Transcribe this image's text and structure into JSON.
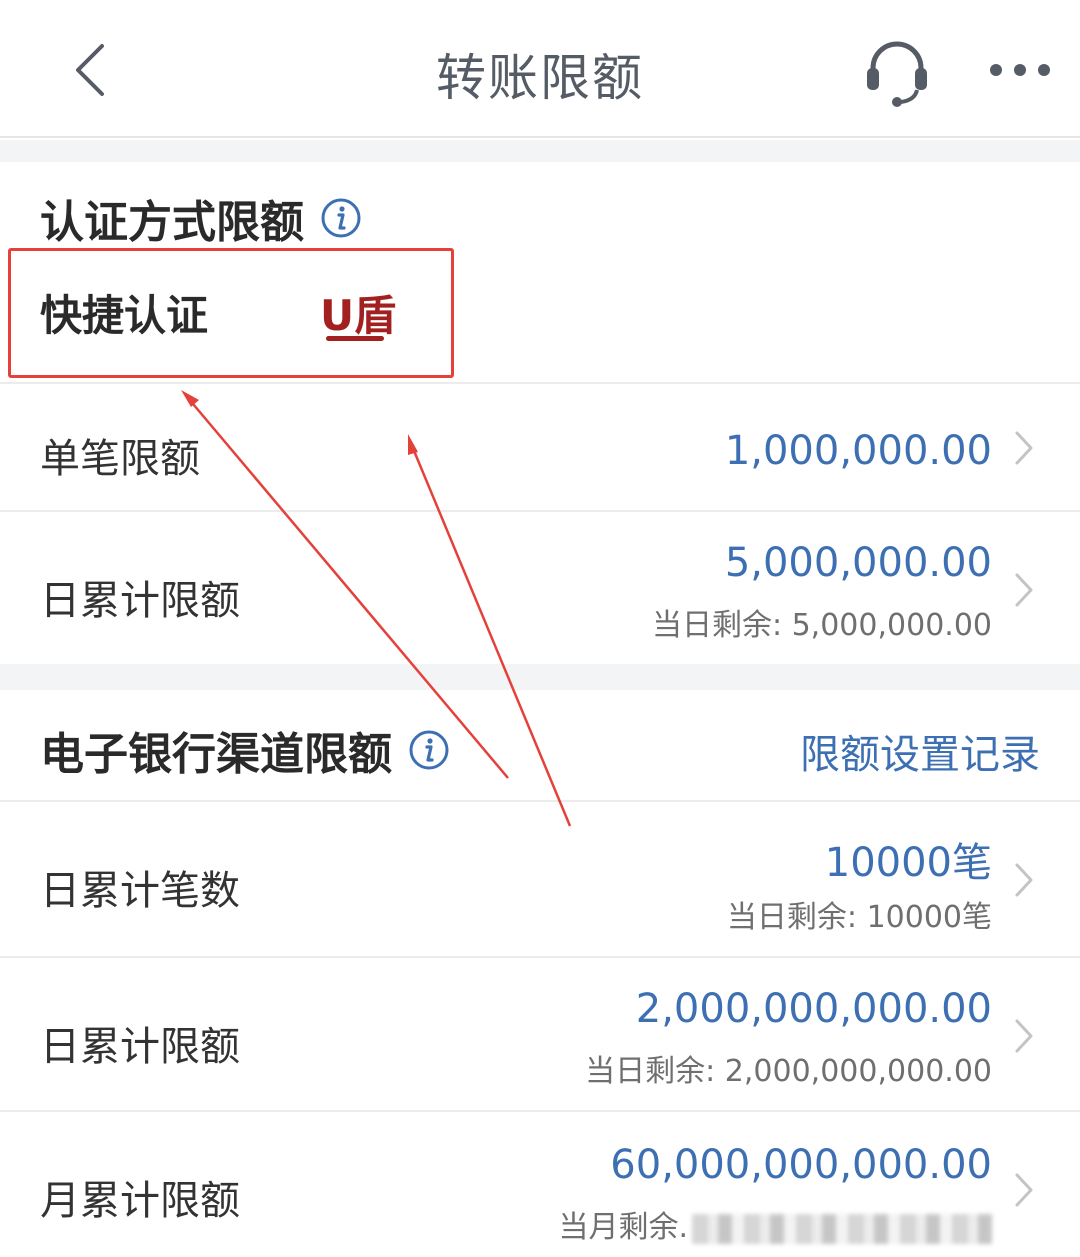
{
  "header": {
    "title": "转账限额",
    "back_icon": "chevron-left-icon",
    "support_icon": "headset-icon",
    "more_icon": "more-dots-icon"
  },
  "auth_section": {
    "title": "认证方式限额",
    "info_icon": "info-icon",
    "method_label": "快捷认证",
    "method_value": "U盾",
    "rows": [
      {
        "label": "单笔限额",
        "value": "1,000,000.00"
      },
      {
        "label": "日累计限额",
        "value": "5,000,000.00",
        "sub": "当日剩余: 5,000,000.00"
      }
    ]
  },
  "channel_section": {
    "title": "电子银行渠道限额",
    "info_icon": "info-icon",
    "records_link": "限额设置记录",
    "rows": [
      {
        "label": "日累计笔数",
        "value": "10000笔",
        "sub": "当日剩余: 10000笔"
      },
      {
        "label": "日累计限额",
        "value": "2,000,000,000.00",
        "sub": "当日剩余: 2,000,000,000.00"
      },
      {
        "label": "月累计限额",
        "value": "60,000,000,000.00",
        "sub": "当月剩余."
      }
    ]
  },
  "colors": {
    "accent_blue": "#3d6fb3",
    "ushield_red": "#a32020",
    "annotation_red": "#e4413a"
  }
}
